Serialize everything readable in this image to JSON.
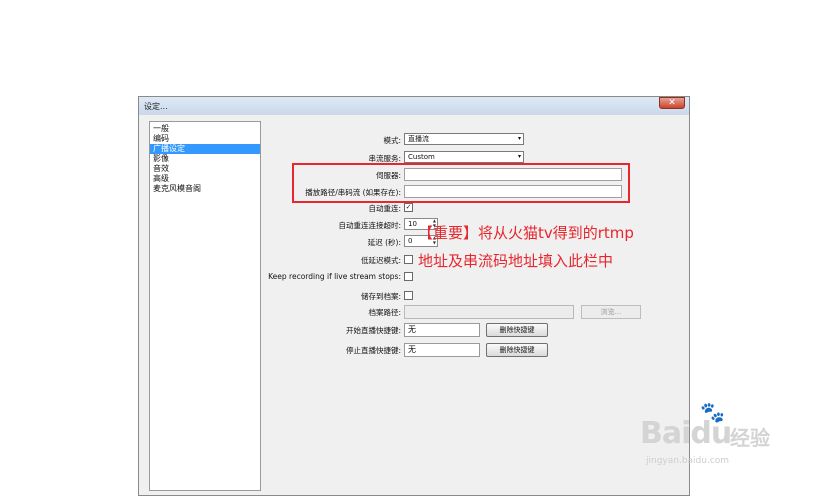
{
  "dialog": {
    "title": "设定...",
    "close_glyph": "✕"
  },
  "nav": {
    "items": [
      {
        "label": "一般"
      },
      {
        "label": "编码"
      },
      {
        "label": "广播设定"
      },
      {
        "label": "影像"
      },
      {
        "label": "音效"
      },
      {
        "label": "高级"
      },
      {
        "label": "麦克风模音阁"
      }
    ],
    "selected_index": 2
  },
  "form": {
    "mode": {
      "label": "模式:",
      "value": "直播流"
    },
    "service": {
      "label": "串流服务:",
      "value": "Custom"
    },
    "server": {
      "label": "伺服器:",
      "value": ""
    },
    "stream_key": {
      "label": "播放路径/串码流 (如果存在):",
      "value": ""
    },
    "auto_reconnect": {
      "label": "自动重连:",
      "checked_glyph": "✓"
    },
    "reconnect_timeout": {
      "label": "自动重连连接超时:",
      "value": "10"
    },
    "delay": {
      "label": "延迟 (秒):",
      "value": "0"
    },
    "low_latency": {
      "label": "低延迟模式:"
    },
    "keep_recording": {
      "label": "Keep recording if live stream stops:"
    },
    "save_to_file": {
      "label": "储存到档案:"
    },
    "file_path": {
      "label": "档案路径:",
      "browse_label": "浏览..."
    },
    "start_hotkey": {
      "label": "开始直播快捷键:",
      "value": "无",
      "clear_label": "删除快捷键"
    },
    "stop_hotkey": {
      "label": "停止直播快捷键:",
      "value": "无",
      "clear_label": "删除快捷键"
    }
  },
  "annotation": {
    "line1": "【重要】将从火猫tv得到的rtmp",
    "line2": "地址及串流码地址填入此栏中",
    "color": "#e8262d"
  },
  "watermark": {
    "logo": "Bai",
    "logo_suffix": "du",
    "jingyan": "经验",
    "url": "jingyan.baidu.com"
  },
  "icons": {
    "dropdown_arrow": "▾",
    "spin_up": "▲",
    "spin_down": "▼",
    "paw": "🐾"
  }
}
